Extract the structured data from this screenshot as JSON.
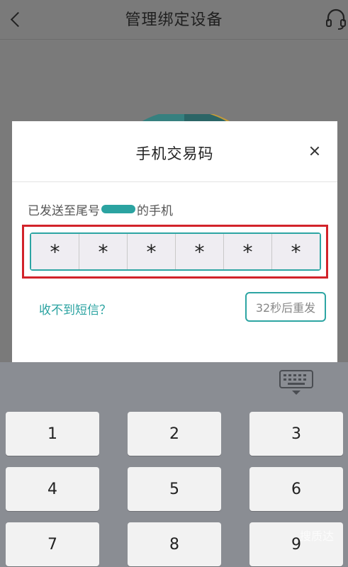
{
  "header": {
    "title": "管理绑定设备"
  },
  "dialog": {
    "title": "手机交易码",
    "sent_prefix": "已发送至尾号",
    "sent_suffix": "的手机",
    "code_cells": [
      "*",
      "*",
      "*",
      "*",
      "*",
      "*"
    ],
    "no_sms_link": "收不到短信？",
    "resend_label": "32秒后重发"
  },
  "keyboard": {
    "keys": [
      "1",
      "2",
      "3",
      "4",
      "5",
      "6",
      "7",
      "8",
      "9"
    ]
  },
  "watermark": "搜质达",
  "colors": {
    "accent": "#2ba3a1",
    "highlight": "#d2232a",
    "overlay": "#7a7a7a"
  }
}
